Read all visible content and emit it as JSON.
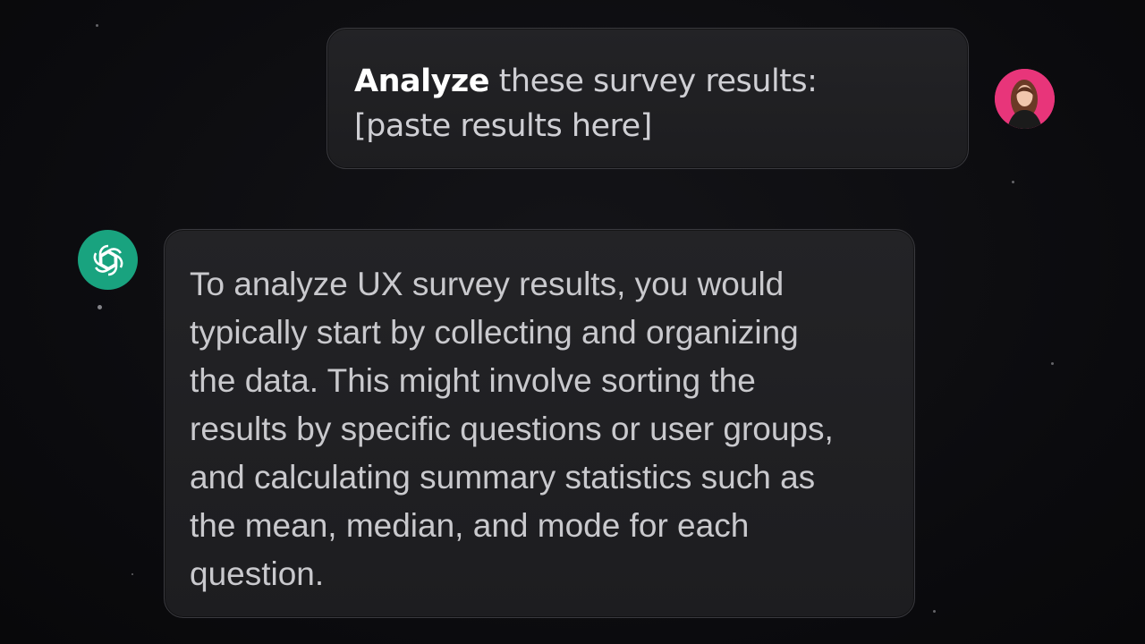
{
  "conversation": {
    "user_message": {
      "bold": "Analyze",
      "rest": " these survey results:",
      "line2": "[paste results here]"
    },
    "assistant_message": {
      "lines": [
        "To analyze UX survey results, you would",
        "typically start by collecting and organizing",
        "the data. This might involve sorting the",
        "results by specific questions or user groups,",
        "and calculating summary statistics such as",
        "the mean, median, and mode for each",
        "question."
      ]
    }
  },
  "icons": {
    "user_avatar": "user-avatar-photo",
    "assistant_logo": "openai-logo-icon"
  },
  "colors": {
    "background": "#0c0c0f",
    "bubble": "#212124",
    "assistant_accent": "#19a37f",
    "avatar_accent": "#e8357a"
  }
}
